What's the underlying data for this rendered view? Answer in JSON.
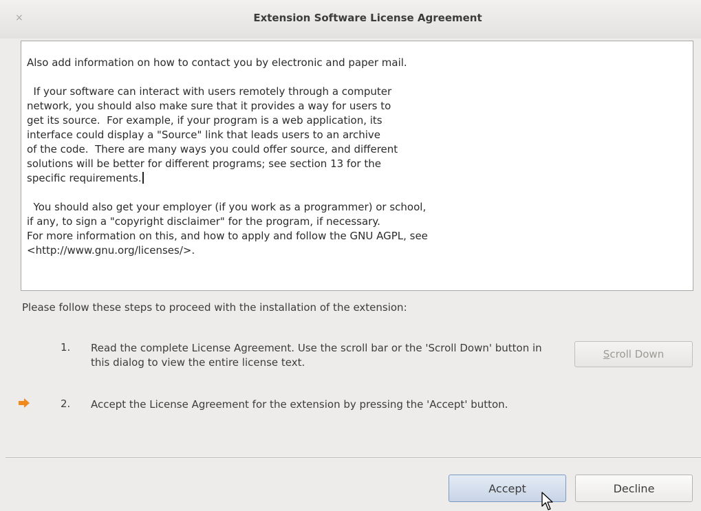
{
  "window": {
    "title": "Extension Software License Agreement",
    "close_glyph": "×"
  },
  "license": {
    "text_main": "Also add information on how to contact you by electronic and paper mail.\n\n  If your software can interact with users remotely through a computer\nnetwork, you should also make sure that it provides a way for users to\nget its source.  For example, if your program is a web application, its\ninterface could display a \"Source\" link that leads users to an archive\nof the code.  There are many ways you could offer source, and different\nsolutions will be better for different programs; see section 13 for the\nspecific requirements.",
    "text_rest": "\n\n  You should also get your employer (if you work as a programmer) or school,\nif any, to sign a \"copyright disclaimer\" for the program, if necessary.\nFor more information on this, and how to apply and follow the GNU AGPL, see\n<http://www.gnu.org/licenses/>."
  },
  "instructions": {
    "intro": "Please follow these steps to proceed with the installation of the extension:",
    "steps": [
      {
        "number": "1.",
        "text": "Read the complete License Agreement. Use the scroll bar or the 'Scroll Down' button in this dialog to view the entire license text."
      },
      {
        "number": "2.",
        "text": "Accept the License Agreement for the extension by pressing the 'Accept' button."
      }
    ],
    "current_step_icon": "arrow-right-icon"
  },
  "buttons": {
    "scroll_down_mnemonic": "S",
    "scroll_down_rest": "croll Down",
    "accept": "Accept",
    "decline": "Decline"
  },
  "colors": {
    "arrow": "#f08a1c",
    "accept_border": "#7b9ac3"
  }
}
